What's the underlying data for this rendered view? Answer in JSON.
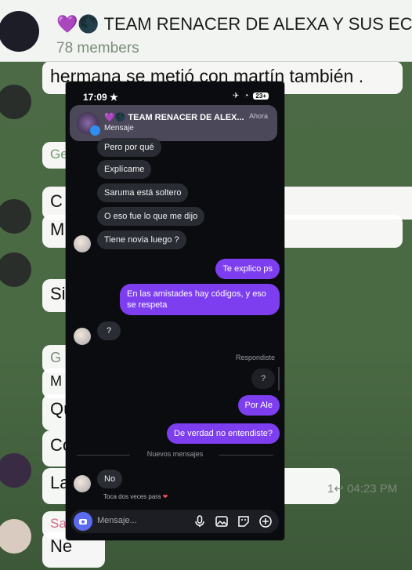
{
  "telegram": {
    "group_title": "💜🌑 TEAM RENACER DE ALEXA Y SUS EC",
    "members": "78 members",
    "bg_messages": [
      {
        "text": "hermana se metió con martín también ."
      },
      {
        "text": "Ge"
      },
      {
        "text": "C                                  o es de familia po"
      },
      {
        "text": "M"
      },
      {
        "text": "Si"
      },
      {
        "text": "G"
      },
      {
        "text": "M"
      },
      {
        "text": "Qu"
      },
      {
        "text": "Co"
      },
      {
        "text": "La                                                   mily!"
      },
      {
        "text": "Sa"
      },
      {
        "text": "Ne"
      }
    ],
    "meta_reply": "1↩ 04:23 PM"
  },
  "phone": {
    "status": {
      "time": "17:09 ★",
      "battery": "23+"
    },
    "notification": {
      "title": "💜🌑 TEAM RENACER DE ALEX...",
      "time": "Ahora",
      "subtitle": "Mensaje"
    },
    "incoming": [
      {
        "text": "Pero por qué"
      },
      {
        "text": "Explícame"
      },
      {
        "text": "Saruma está soltero"
      },
      {
        "text": "O eso fue lo que me dijo"
      },
      {
        "text": "Tiene novia luego ?"
      },
      {
        "text": "?"
      },
      {
        "text": "No"
      }
    ],
    "outgoing": [
      {
        "text": "Te explico ps"
      },
      {
        "text": "En las amistades hay códigos, y eso se respeta"
      },
      {
        "text": "Por Ale"
      },
      {
        "text": "De verdad no entendiste?"
      }
    ],
    "replied_label": "Respondiste",
    "replied_quote": "?",
    "new_messages": "Nuevos mensajes",
    "tap_note": "Toca dos veces para",
    "composer_placeholder": "Mensaje...",
    "colors": {
      "outgoing": "#7d3ef0",
      "incoming": "#2a2c33",
      "background": "#0b0c10"
    }
  }
}
